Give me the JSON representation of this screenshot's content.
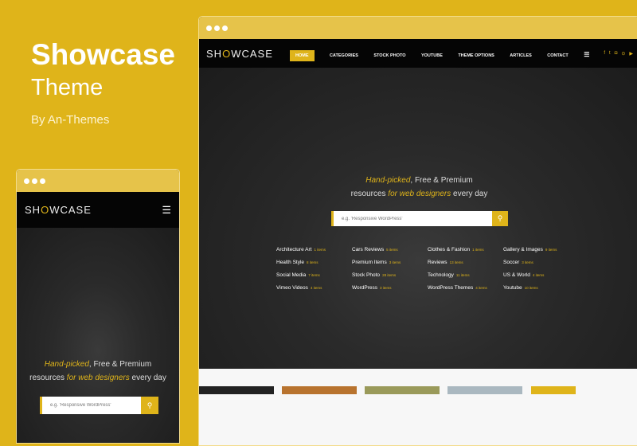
{
  "promo": {
    "title": "Showcase",
    "subtitle": "Theme",
    "author": "By An-Themes"
  },
  "site": {
    "logo_pre": "SH",
    "logo_mark": "O",
    "logo_post": "WCASE",
    "nav": [
      "HOME",
      "CATEGORIES",
      "STOCK PHOTO",
      "YOUTUBE",
      "THEME OPTIONS",
      "ARTICLES",
      "CONTACT"
    ],
    "social": [
      "facebook-icon",
      "twitter-icon",
      "instagram-icon",
      "pinterest-icon",
      "youtube-icon"
    ],
    "tagline": {
      "hl1": "Hand-picked",
      "t1": ", Free & Premium",
      "t2a": "resources ",
      "hl2": "for web designers",
      "t2b": " every day"
    },
    "search_placeholder": "e.g. 'Responsive WordPress'",
    "categories": [
      {
        "name": "Architecture Art",
        "count": "1 items"
      },
      {
        "name": "Cars Reviews",
        "count": "5 items"
      },
      {
        "name": "Clothes & Fashion",
        "count": "1 items"
      },
      {
        "name": "Gallery & Images",
        "count": "9 items"
      },
      {
        "name": "Health Style",
        "count": "8 items"
      },
      {
        "name": "Premium Items",
        "count": "3 items"
      },
      {
        "name": "Reviews",
        "count": "13 items"
      },
      {
        "name": "Soccer",
        "count": "3 items"
      },
      {
        "name": "Social Media",
        "count": "7 items"
      },
      {
        "name": "Stock Photo",
        "count": "28 items"
      },
      {
        "name": "Technology",
        "count": "11 items"
      },
      {
        "name": "US & World",
        "count": "4 items"
      },
      {
        "name": "Vimeo Videos",
        "count": "4 items"
      },
      {
        "name": "WordPress",
        "count": "3 items"
      },
      {
        "name": "WordPress Themes",
        "count": "4 items"
      },
      {
        "name": "Youtube",
        "count": "10 items"
      }
    ]
  },
  "colors": {
    "accent": "#dfb41a",
    "bar": "#e6c34a"
  }
}
